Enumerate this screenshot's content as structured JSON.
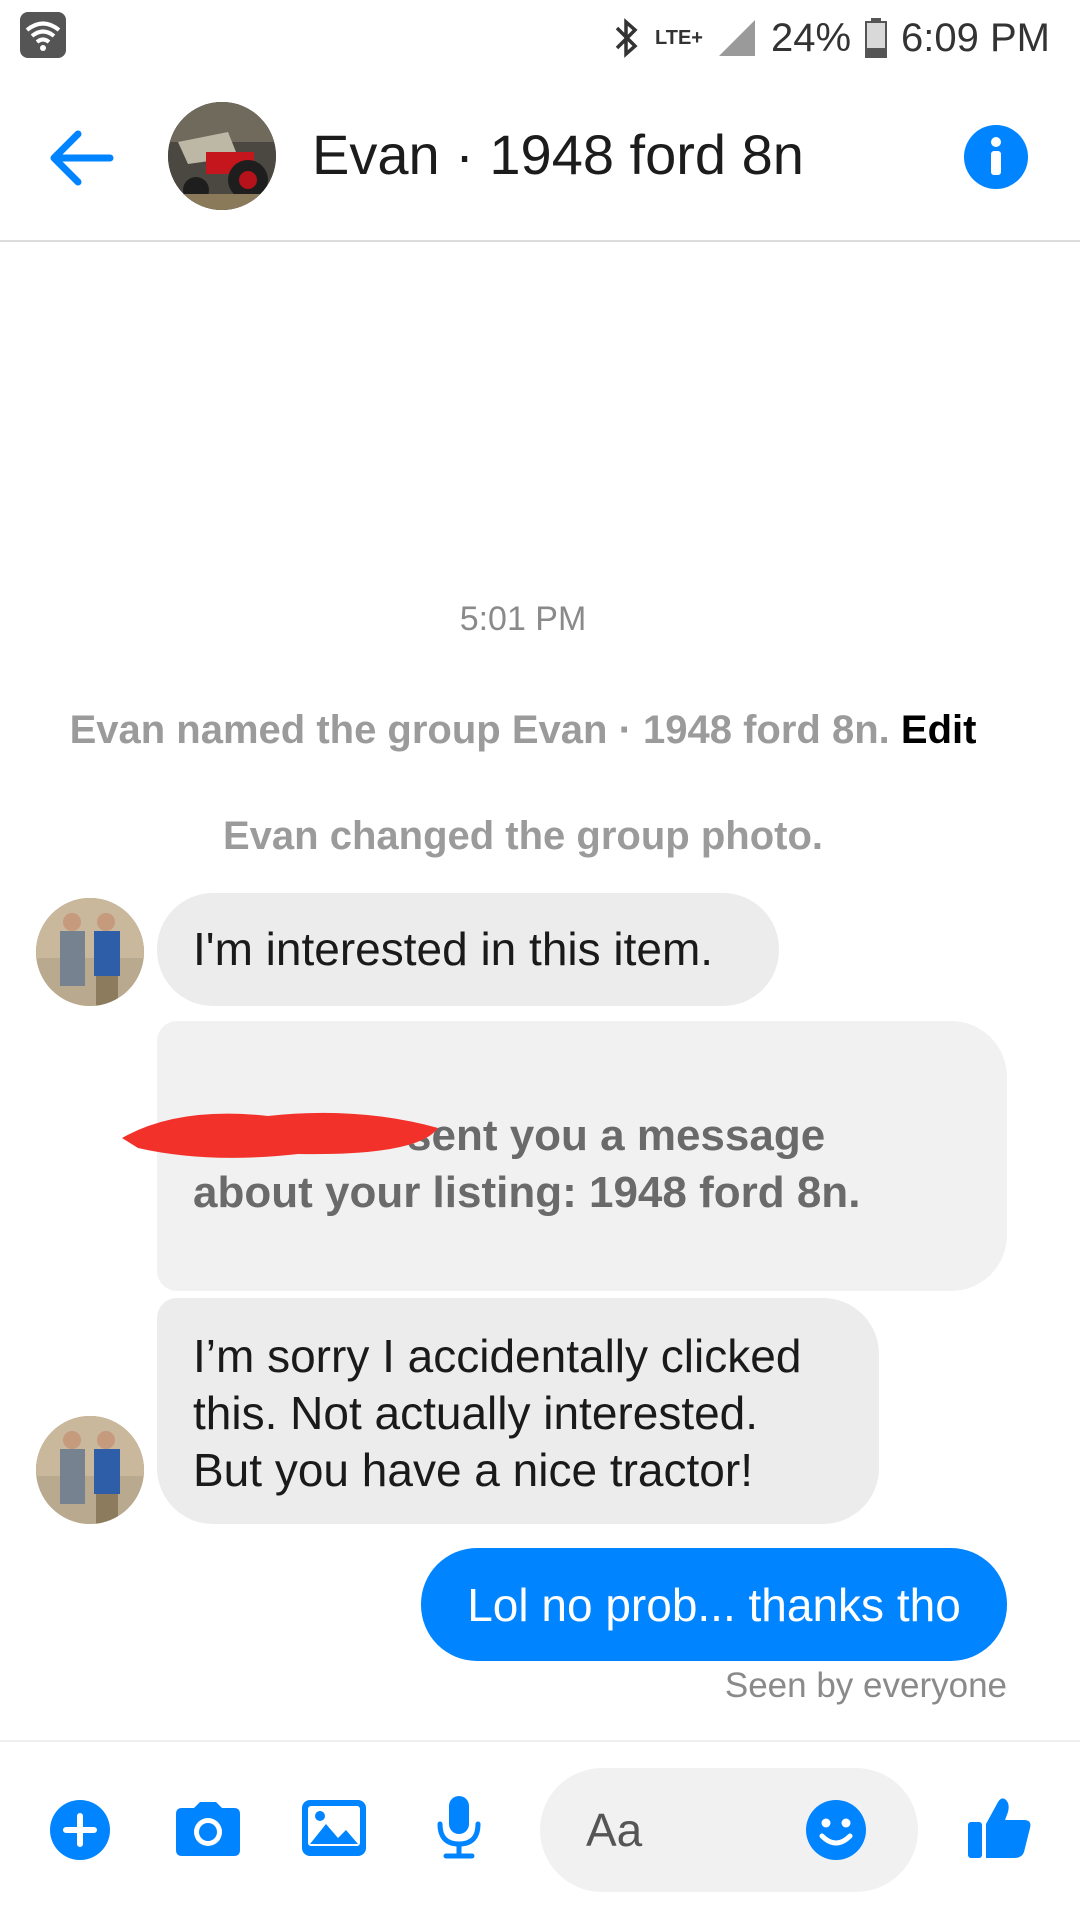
{
  "status_bar": {
    "network": "LTE+",
    "battery": "24%",
    "time": "6:09 PM"
  },
  "header": {
    "title": "Evan · 1948 ford 8n"
  },
  "conversation": {
    "timestamp": "5:01 PM",
    "system_messages": [
      {
        "text": "Evan named the group Evan · 1948 ford 8n.",
        "action": "Edit"
      },
      {
        "text": "Evan changed the group photo."
      }
    ],
    "messages": [
      {
        "from": "other",
        "text": "I'm interested in this item."
      },
      {
        "from": "other",
        "text_line1": "sent you a message",
        "text_line2": "about your listing: 1948 ford 8n."
      },
      {
        "from": "other",
        "lines": [
          "I’m sorry I accidentally clicked",
          "this. Not actually interested.",
          "But you have a nice tractor!"
        ]
      },
      {
        "from": "me",
        "text": "Lol no prob... thanks tho"
      }
    ],
    "seen": "Seen by everyone"
  },
  "composer": {
    "placeholder": "Aa"
  },
  "colors": {
    "accent": "#0084ff",
    "incoming_bubble": "#ececec",
    "muted_text": "#9b9b9b"
  },
  "icons": [
    "wifi-icon",
    "bluetooth-icon",
    "signal-icon",
    "battery-icon",
    "back-arrow-icon",
    "info-icon",
    "plus-icon",
    "camera-icon",
    "image-icon",
    "microphone-icon",
    "emoji-icon",
    "thumbs-up-icon"
  ]
}
